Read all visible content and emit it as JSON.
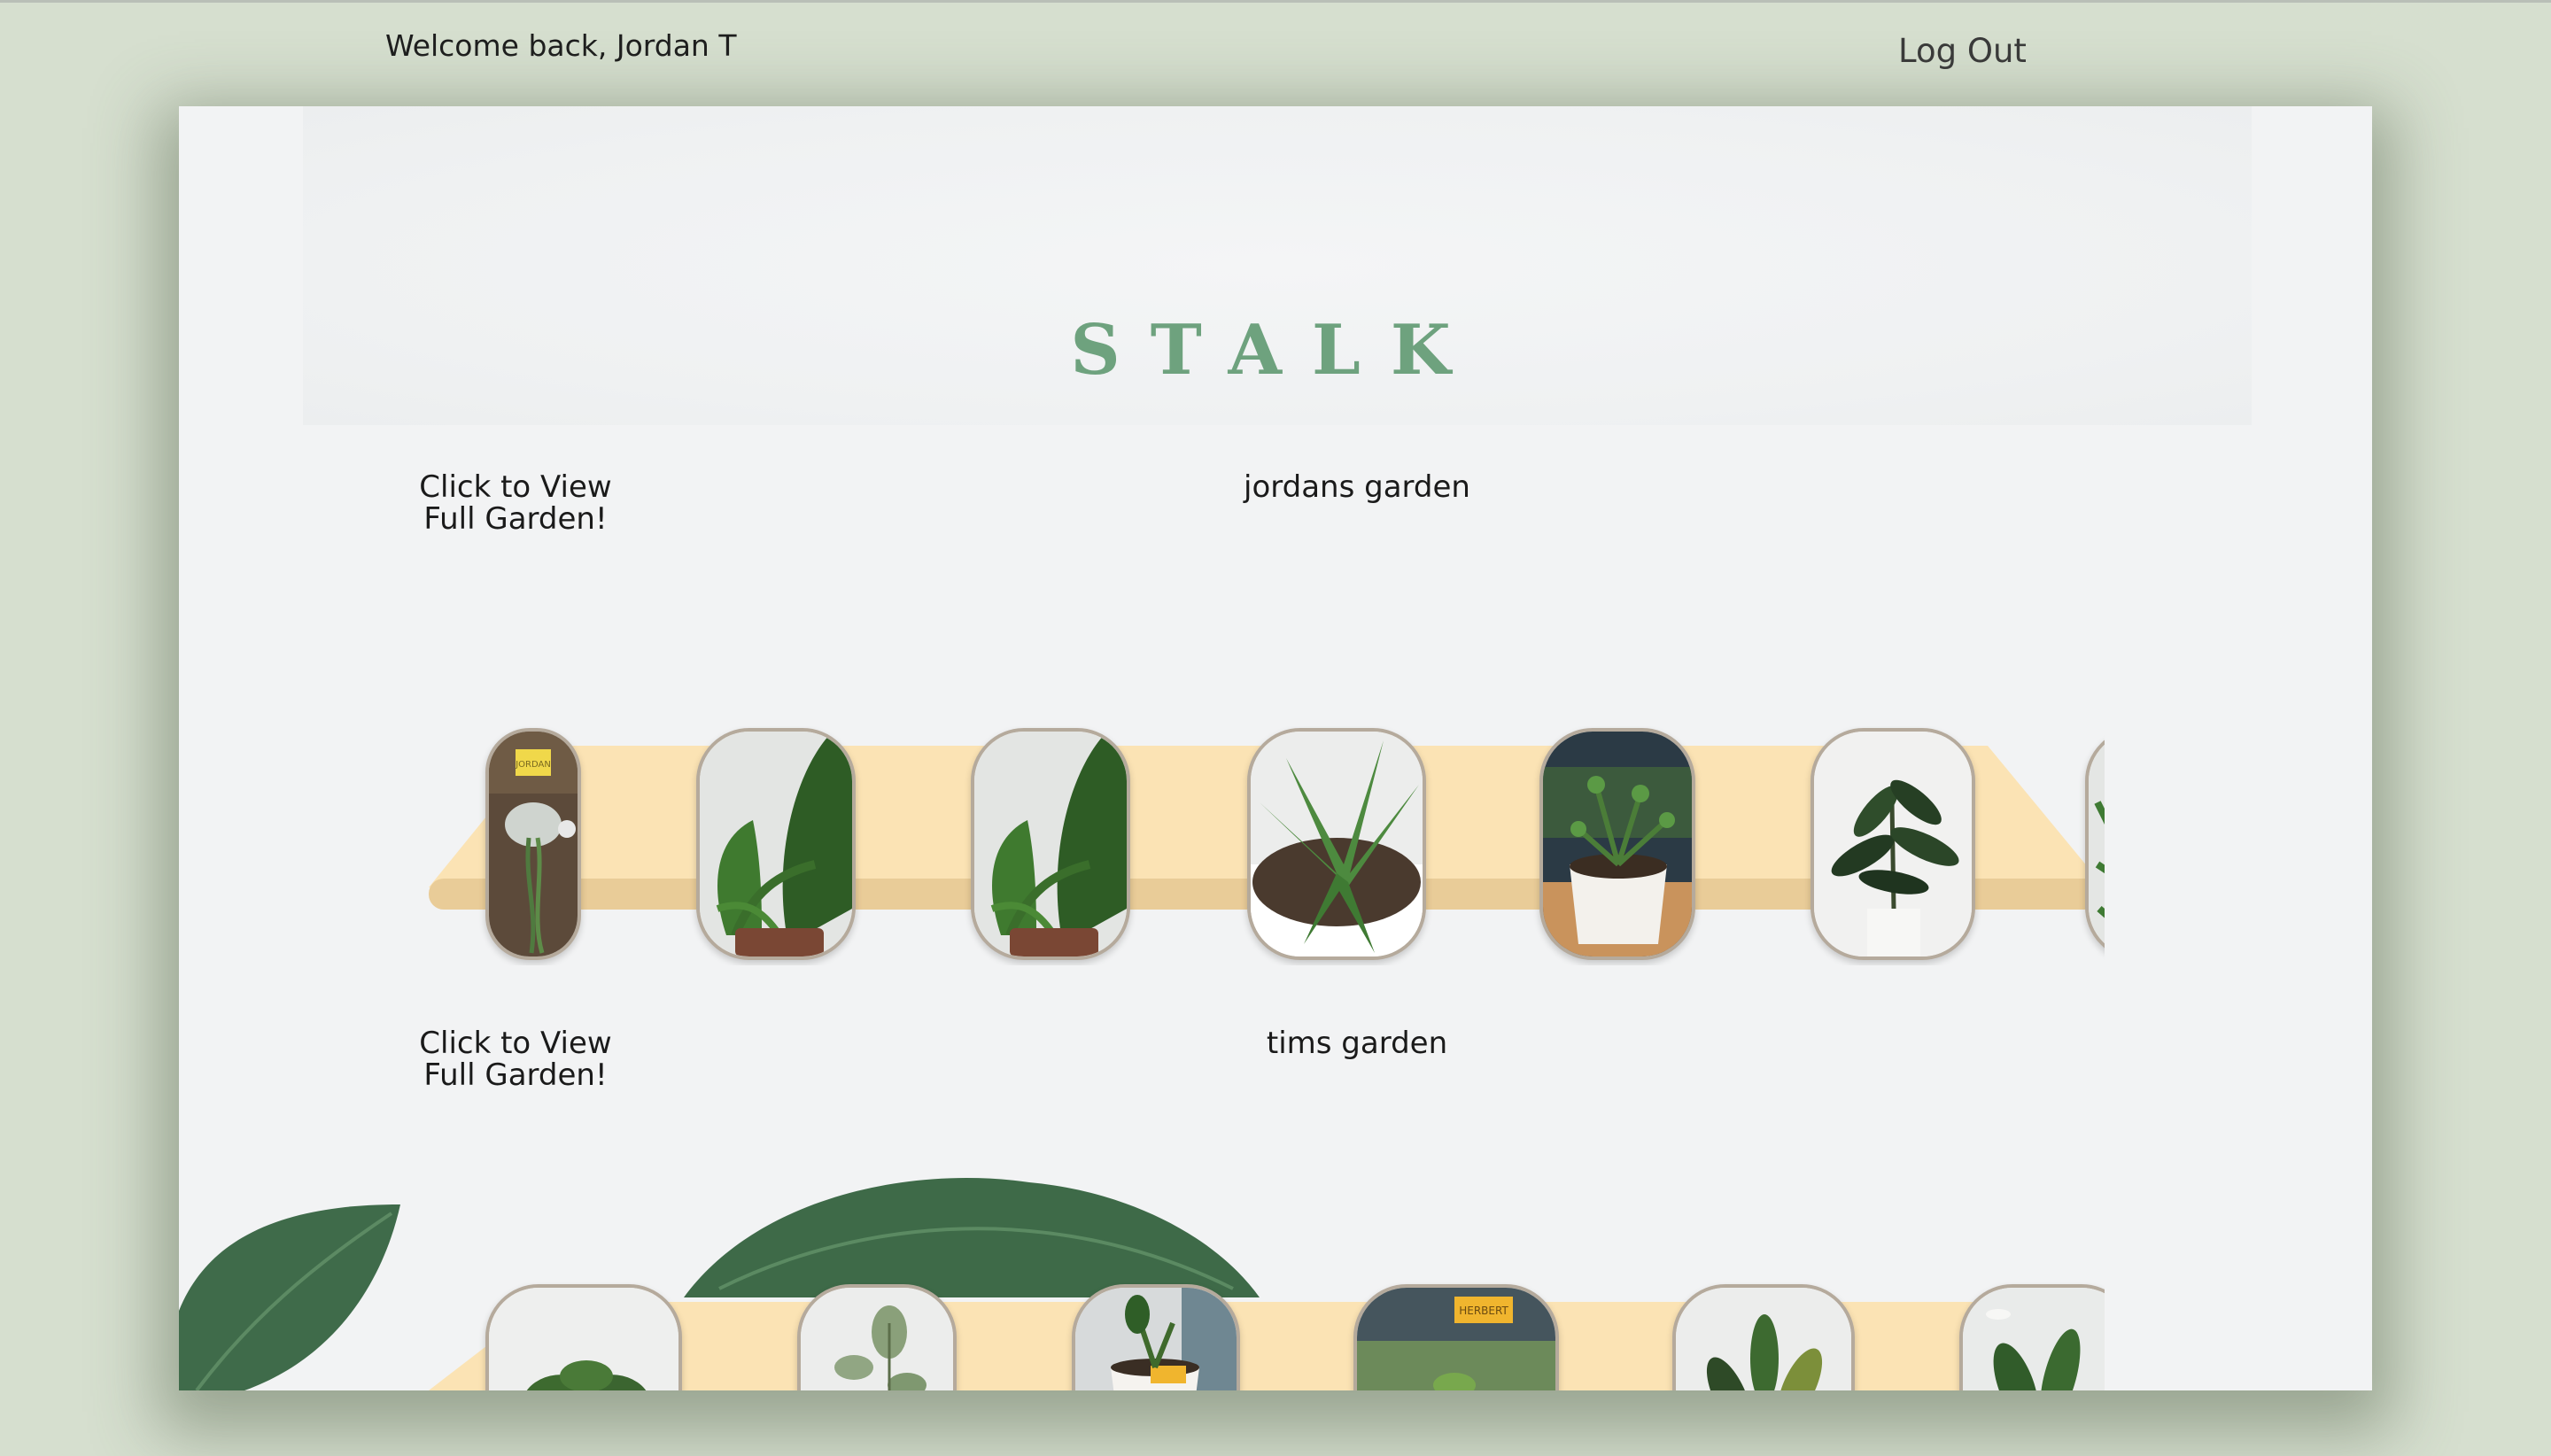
{
  "header": {
    "welcome": "Welcome back, Jordan T",
    "logout": "Log Out"
  },
  "brand": {
    "logo": "STALK",
    "accent": "#6ea27e"
  },
  "gardens": [
    {
      "title": "jordans garden",
      "view_link": "Click to View Full Garden!"
    },
    {
      "title": "tims garden",
      "view_link": "Click to View Full Garden!"
    }
  ],
  "colors": {
    "page_bg": "#d6dfcf",
    "frame_bg": "#f2f3f4",
    "shelf": "#fbe3b4",
    "shelf_edge": "#e9cc98",
    "card_border": "#b5aa9c"
  },
  "plant_labels": {
    "hanging_tag": "JORDAN",
    "pot_tag": "HERBERT"
  }
}
